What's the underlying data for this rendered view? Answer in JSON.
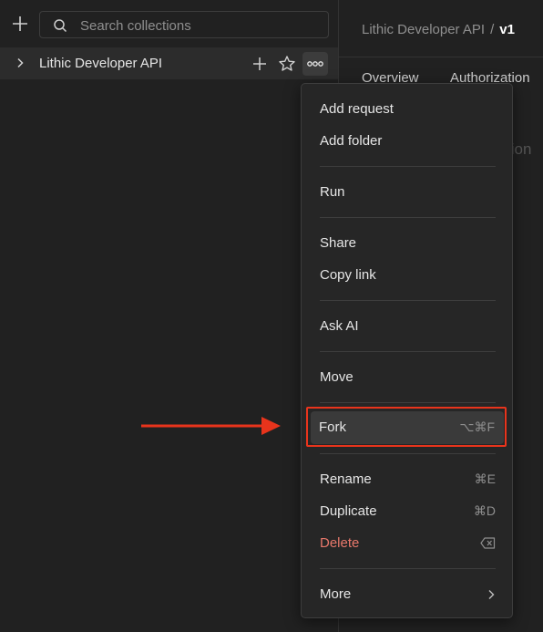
{
  "search": {
    "placeholder": "Search collections",
    "value": ""
  },
  "collection": {
    "name": "Lithic Developer API"
  },
  "breadcrumb": {
    "parent": "Lithic Developer API",
    "separator": "/",
    "current": "v1"
  },
  "tabs": [
    "Overview",
    "Authorization"
  ],
  "ghost": "tion",
  "menu": {
    "items": [
      {
        "label": "Add request"
      },
      {
        "label": "Add folder"
      },
      {
        "label": "Run"
      },
      {
        "label": "Share"
      },
      {
        "label": "Copy link"
      },
      {
        "label": "Ask AI"
      },
      {
        "label": "Move"
      },
      {
        "label": "Fork",
        "shortcut": "⌥⌘F"
      },
      {
        "label": "Rename",
        "shortcut": "⌘E"
      },
      {
        "label": "Duplicate",
        "shortcut": "⌘D"
      },
      {
        "label": "Delete"
      },
      {
        "label": "More"
      }
    ]
  },
  "colors": {
    "accent_red": "#e8341c",
    "delete_red": "#e8786b"
  }
}
